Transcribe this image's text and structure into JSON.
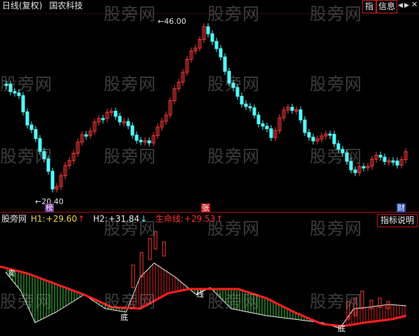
{
  "header": {
    "title": "日线(复权)",
    "stock_name": "国农科技",
    "btn_index": "指",
    "btn_info": "信息",
    "btn_left": "◀",
    "btn_right": "▶",
    "btn_close": "✕"
  },
  "price_panel": {
    "high_label": "46.00",
    "low_label": "20.40",
    "badge_bang": "榜",
    "badge_zhang": "张",
    "badge_cai": "财"
  },
  "indicator": {
    "name": "股旁网",
    "h1_label": "H1:",
    "h1_value": "+29.60",
    "h1_arrow": "↑",
    "h2_label": "H2:",
    "h2_value": "+31.84",
    "h2_arrow": "↓",
    "life_label": "生命线:",
    "life_value": "+29.53",
    "life_arrow": "↑",
    "help_button": "指标说明",
    "mark_sell": "卖",
    "mark_bottom1": "底",
    "mark_line": "线",
    "mark_bottom2": "底"
  },
  "watermark": "股旁网",
  "colors": {
    "up": "#ff3c3c",
    "down": "#54ffff",
    "life_line": "#ff2020",
    "h_line": "#f5f5f5",
    "fill_green": "#3cd33c",
    "fill_red": "#e02020",
    "divider": "#b01010"
  }
}
